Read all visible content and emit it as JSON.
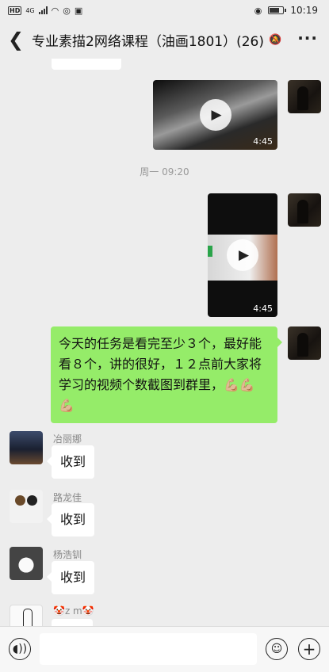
{
  "status_bar": {
    "network": "HD",
    "signal_type": "4G",
    "time": "10:19"
  },
  "header": {
    "back_icon": "chevron-left-icon",
    "title": "专业素描2网络课程（油画1801）(26)",
    "mute_icon": "bell-muted-icon",
    "more_icon": "more-dots-icon"
  },
  "chat": {
    "messages": [
      {
        "type": "video",
        "sender": "me",
        "duration": "4:45"
      },
      {
        "type": "timestamp",
        "text": "周一 09:20"
      },
      {
        "type": "video",
        "sender": "me",
        "duration": "4:45"
      },
      {
        "type": "text",
        "sender": "me",
        "text": "今天的任务是看完至少３个，最好能看８个，讲的很好，１２点前大家将学习的视频个数截图到群里，💪🏼💪🏼💪🏼"
      },
      {
        "type": "text",
        "sender": "冶丽娜",
        "text": "收到"
      },
      {
        "type": "text",
        "sender": "路龙佳",
        "text": "收到"
      },
      {
        "type": "text",
        "sender": "杨浩钏",
        "text": "收到"
      },
      {
        "type": "text",
        "sender": "🤡z m🤡",
        "text": ""
      }
    ]
  },
  "input_bar": {
    "voice_icon": "voice-icon",
    "emoji_icon": "emoji-icon",
    "plus_icon": "plus-icon",
    "placeholder": ""
  },
  "colors": {
    "background": "#ededed",
    "my_bubble": "#95ec69",
    "their_bubble": "#ffffff",
    "nickname": "#888888"
  }
}
